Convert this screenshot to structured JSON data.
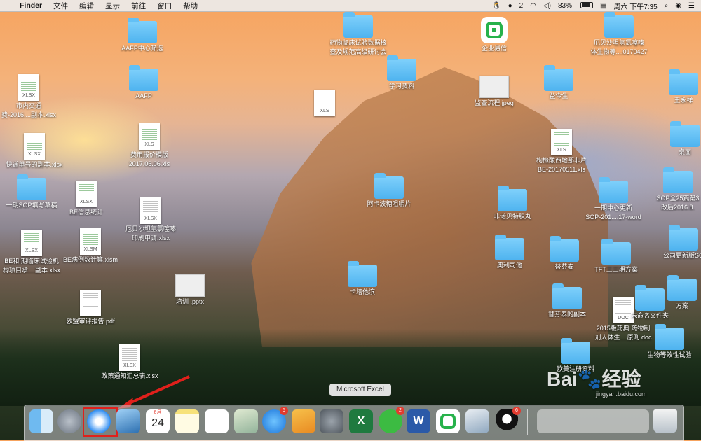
{
  "menubar": {
    "apple": "",
    "app_name": "Finder",
    "menus": [
      "文件",
      "编辑",
      "显示",
      "前往",
      "窗口",
      "帮助"
    ],
    "status": {
      "notifications": "2",
      "battery": "83%",
      "datetime": "周六 下午7:35"
    }
  },
  "desktop": {
    "items": [
      {
        "name": "AAFP中心筛选",
        "type": "folder"
      },
      {
        "name": "AAFP",
        "type": "folder"
      },
      {
        "name": "市内交通费-2016...副本.xlsx",
        "line1": "市内交通",
        "line2": "费-2016....副本.xlsx",
        "type": "xlsx"
      },
      {
        "name": "费用报价模版2017.06.06.xls",
        "line1": "费用报价模版",
        "line2": "2017.06.06.xls",
        "type": "xls"
      },
      {
        "name": "快递单号的副本.xlsx",
        "type": "xlsx"
      },
      {
        "name": "一期SOP填写草稿",
        "type": "folder"
      },
      {
        "name": "BE信息统计",
        "type": "xlsx"
      },
      {
        "name": "厄贝沙坦氢氯噻嗪印刷申请.xlsx",
        "line1": "厄贝沙坦氢氯噻嗪",
        "line2": "印刷申请.xlsx",
        "type": "xlsx"
      },
      {
        "name": "BE和I期临床试验机构项目承...副本.xlsx",
        "line1": "BE和I期临床试验机",
        "line2": "构项目承....副本.xlsx",
        "type": "xlsx"
      },
      {
        "name": "BE病例数计算.xlsm",
        "type": "xlsm"
      },
      {
        "name": "培训 .pptx",
        "type": "pptx"
      },
      {
        "name": "欧盟审评报告.pdf",
        "type": "pdf"
      },
      {
        "name": "政策通知汇总表.xlsx",
        "type": "xlsx"
      },
      {
        "name": "药物临床试验数据核查及规范高级研讨会",
        "line1": "药物临床试验数据核",
        "line2": "查及规范高级研讨会",
        "type": "folder"
      },
      {
        "name": "学习资料",
        "type": "folder"
      },
      {
        "name": "企业易信",
        "type": "app"
      },
      {
        "name": "监查流程.jpeg",
        "type": "jpeg"
      },
      {
        "name": "益今生",
        "type": "folder"
      },
      {
        "name": "厄贝沙坦氢氯噻嗪体生物等...0170427",
        "line1": "厄贝沙坦氢氯噻嗪",
        "line2": "体生物等....0170427",
        "type": "folder"
      },
      {
        "name": "王永祥",
        "type": "folder"
      },
      {
        "name": "桌面",
        "type": "folder"
      },
      {
        "name": "枸橼酸西地那非片BE-20170511.xls",
        "line1": "枸橼酸西地那非片",
        "line2": "BE-20170511.xls",
        "type": "xls"
      },
      {
        "name": "阿卡波糖咀嚼片",
        "type": "folder"
      },
      {
        "name": "非诺贝特胶丸",
        "type": "folder"
      },
      {
        "name": "一期中心更新SOP-201....17-word",
        "line1": "一期中心更新",
        "line2": "SOP-201....17-word",
        "type": "folder"
      },
      {
        "name": "SOP全25篇第3改后2016.8.",
        "line1": "SOP全25篇第3",
        "line2": "改后2016.8.",
        "type": "folder"
      },
      {
        "name": "奥利司他",
        "type": "folder"
      },
      {
        "name": "替芬泰",
        "type": "folder"
      },
      {
        "name": "TFT三三期方案",
        "type": "folder"
      },
      {
        "name": "公司更新版SO",
        "type": "folder"
      },
      {
        "name": "卡培他滨",
        "type": "folder"
      },
      {
        "name": "替芬泰的副本",
        "type": "folder"
      },
      {
        "name": "2015版药典 药物制剂人体生...原则.doc",
        "line1": "2015版药典 药物制",
        "line2": "剂人体生....原则.doc",
        "type": "doc"
      },
      {
        "name": "未命名文件夹",
        "type": "folder"
      },
      {
        "name": "方案",
        "type": "folder"
      },
      {
        "name": "生物等效性试验",
        "type": "folder"
      },
      {
        "name": "欧美注册资料",
        "type": "folder"
      },
      {
        "name": "XLS",
        "type": "xls"
      }
    ]
  },
  "dock": {
    "tooltip": "Microsoft Excel",
    "items": [
      {
        "name": "Finder"
      },
      {
        "name": "Launchpad"
      },
      {
        "name": "Safari",
        "highlighted": true
      },
      {
        "name": "Preview"
      },
      {
        "name": "Calendar",
        "month": "6月",
        "day": "24"
      },
      {
        "name": "Notes"
      },
      {
        "name": "Reminders"
      },
      {
        "name": "Photo Booth"
      },
      {
        "name": "App Store",
        "badge": "5"
      },
      {
        "name": "Pages"
      },
      {
        "name": "System Preferences"
      },
      {
        "name": "Microsoft Excel"
      },
      {
        "name": "WeChat",
        "badge": "2"
      },
      {
        "name": "Microsoft Word"
      },
      {
        "name": "企业易信"
      },
      {
        "name": "Image Capture"
      },
      {
        "name": "QQ",
        "badge": "6"
      },
      {
        "name": "Downloads"
      },
      {
        "name": "Trash"
      }
    ]
  },
  "watermark": {
    "brand": "Bai",
    "brand2": "经验",
    "url": "jingyan.baidu.com"
  },
  "colors": {
    "annotation": "#e0201b",
    "folder": "#58b8f2"
  }
}
